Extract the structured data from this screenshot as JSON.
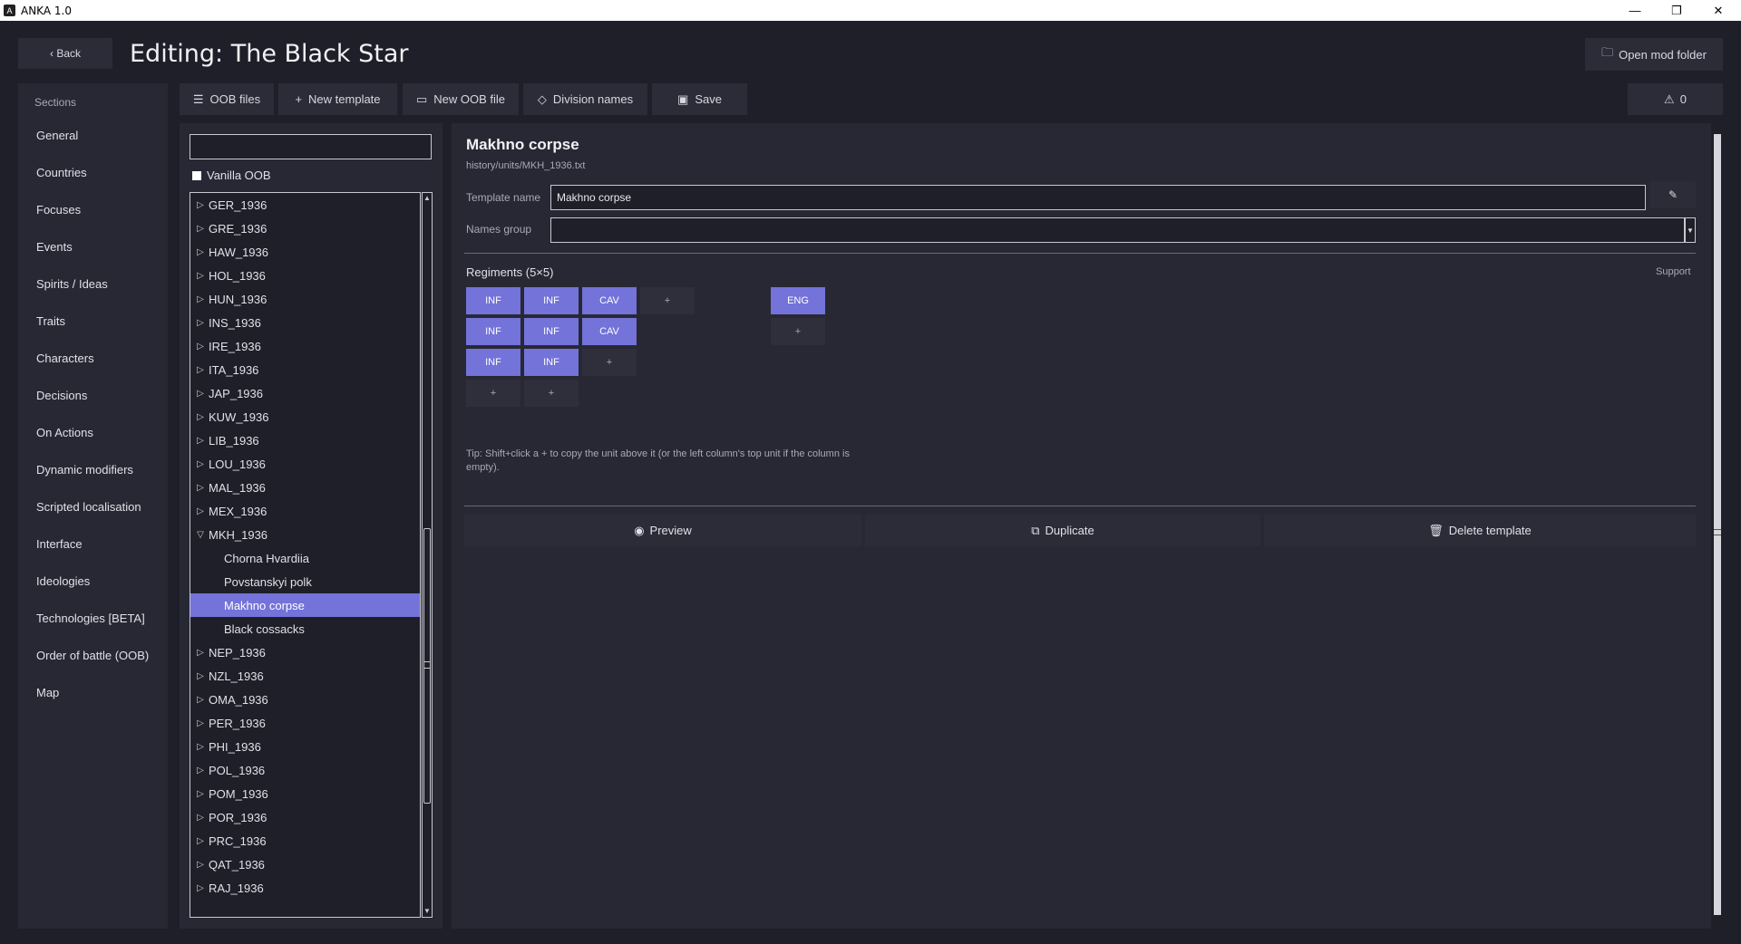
{
  "window": {
    "title": "ANKA 1.0",
    "minimize": "—",
    "restore": "❐",
    "close": "✕"
  },
  "header": {
    "back_label": "‹ Back",
    "title": "Editing: The Black Star",
    "open_mod_folder": "Open mod folder"
  },
  "sidebar": {
    "section_title": "Sections",
    "items": [
      "General",
      "Countries",
      "Focuses",
      "Events",
      "Spirits / Ideas",
      "Traits",
      "Characters",
      "Decisions",
      "On Actions",
      "Dynamic modifiers",
      "Scripted localisation",
      "Interface",
      "Ideologies",
      "Technologies [BETA]",
      "Order of battle (OOB)",
      "Map"
    ]
  },
  "toolbar": {
    "oob_files": "OOB files",
    "new_template": "New template",
    "new_oob_file": "New OOB file",
    "division_names": "Division names",
    "save": "Save",
    "warnings_count": "0"
  },
  "list": {
    "search_value": "",
    "vanilla_oob_label": "Vanilla OOB",
    "items": [
      {
        "label": "GER_1936",
        "expanded": false
      },
      {
        "label": "GRE_1936",
        "expanded": false
      },
      {
        "label": "HAW_1936",
        "expanded": false
      },
      {
        "label": "HOL_1936",
        "expanded": false
      },
      {
        "label": "HUN_1936",
        "expanded": false
      },
      {
        "label": "INS_1936",
        "expanded": false
      },
      {
        "label": "IRE_1936",
        "expanded": false
      },
      {
        "label": "ITA_1936",
        "expanded": false
      },
      {
        "label": "JAP_1936",
        "expanded": false
      },
      {
        "label": "KUW_1936",
        "expanded": false
      },
      {
        "label": "LIB_1936",
        "expanded": false
      },
      {
        "label": "LOU_1936",
        "expanded": false
      },
      {
        "label": "MAL_1936",
        "expanded": false
      },
      {
        "label": "MEX_1936",
        "expanded": false
      },
      {
        "label": "MKH_1936",
        "expanded": true
      },
      {
        "label": "Chorna Hvardiia",
        "child": true
      },
      {
        "label": "Povstanskyi polk",
        "child": true
      },
      {
        "label": "Makhno corpse",
        "child": true,
        "selected": true
      },
      {
        "label": "Black cossacks",
        "child": true
      },
      {
        "label": "NEP_1936",
        "expanded": false
      },
      {
        "label": "NZL_1936",
        "expanded": false
      },
      {
        "label": "OMA_1936",
        "expanded": false
      },
      {
        "label": "PER_1936",
        "expanded": false
      },
      {
        "label": "PHI_1936",
        "expanded": false
      },
      {
        "label": "POL_1936",
        "expanded": false
      },
      {
        "label": "POM_1936",
        "expanded": false
      },
      {
        "label": "POR_1936",
        "expanded": false
      },
      {
        "label": "PRC_1936",
        "expanded": false
      },
      {
        "label": "QAT_1936",
        "expanded": false
      },
      {
        "label": "RAJ_1936",
        "expanded": false
      }
    ]
  },
  "editor": {
    "title": "Makhno corpse",
    "path": "history/units/MKH_1936.txt",
    "template_name_label": "Template name",
    "template_name_value": "Makhno corpse",
    "names_group_label": "Names group",
    "names_group_value": "",
    "regiments_label": "Regiments (5×5)",
    "support_label": "Support",
    "regiment_columns": [
      [
        "INF",
        "INF",
        "INF",
        "+"
      ],
      [
        "INF",
        "INF",
        "INF",
        "+"
      ],
      [
        "CAV",
        "CAV",
        "+"
      ],
      [
        "+"
      ]
    ],
    "support_units": [
      "ENG",
      "+"
    ],
    "tip": "Tip: Shift+click a  +  to copy the unit above it (or the left column's top unit if the column is empty).",
    "preview": "Preview",
    "duplicate": "Duplicate",
    "delete_template": "Delete template"
  },
  "colors": {
    "accent": "#7373d9",
    "background": "#1f1f29",
    "panel": "#282834"
  }
}
